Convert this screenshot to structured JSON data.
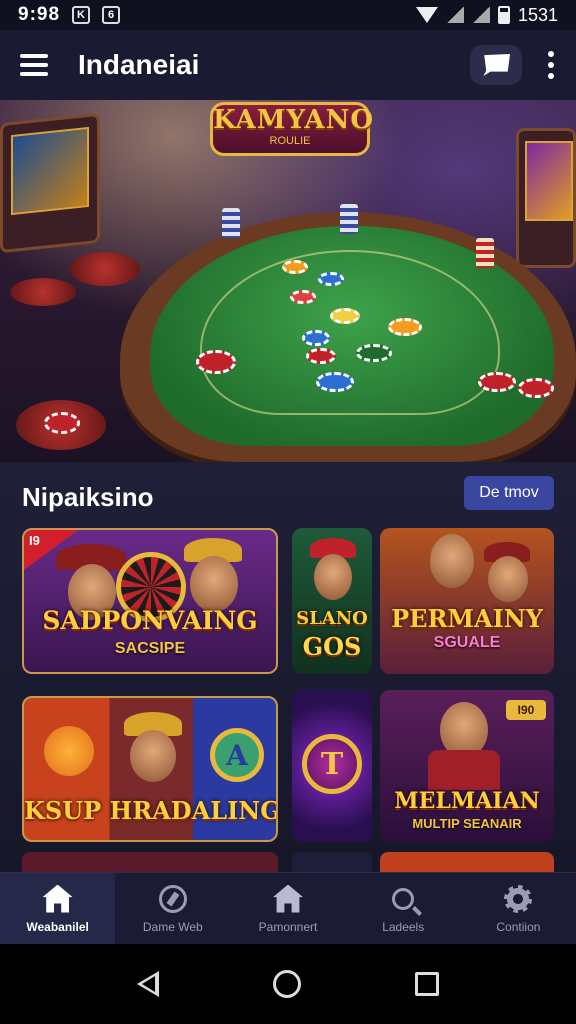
{
  "status_bar": {
    "time": "9:98",
    "icon_a": "K",
    "icon_b": "6",
    "battery_text": "1531"
  },
  "app_bar": {
    "title": "Indaneiai"
  },
  "hero": {
    "logo_title": "KAMYANO",
    "logo_subtitle": "ROULIE"
  },
  "section": {
    "title": "Nipaiksino",
    "demo_button": "De tmov"
  },
  "cards": [
    {
      "badge": "I9",
      "title": "SADPONVAING",
      "subtitle": "SACSIPE"
    },
    {
      "title": "SLANO",
      "subtitle": "GOS"
    },
    {
      "title": "PERMAINY",
      "subtitle": "SGUALE"
    },
    {
      "title": "KSUP HRADALING"
    },
    {
      "title": "T"
    },
    {
      "title": "MELMAIAN",
      "subtitle": "MULTIP SEANAIR",
      "badge": "I90"
    }
  ],
  "bottom_nav": [
    {
      "label": "Weabanilel",
      "icon": "home-icon",
      "active": true
    },
    {
      "label": "Dame Web",
      "icon": "compass-icon",
      "active": false
    },
    {
      "label": "Pamonnert",
      "icon": "home-icon",
      "active": false
    },
    {
      "label": "Ladeels",
      "icon": "search-icon",
      "active": false
    },
    {
      "label": "Contiion",
      "icon": "gear-icon",
      "active": false
    }
  ]
}
